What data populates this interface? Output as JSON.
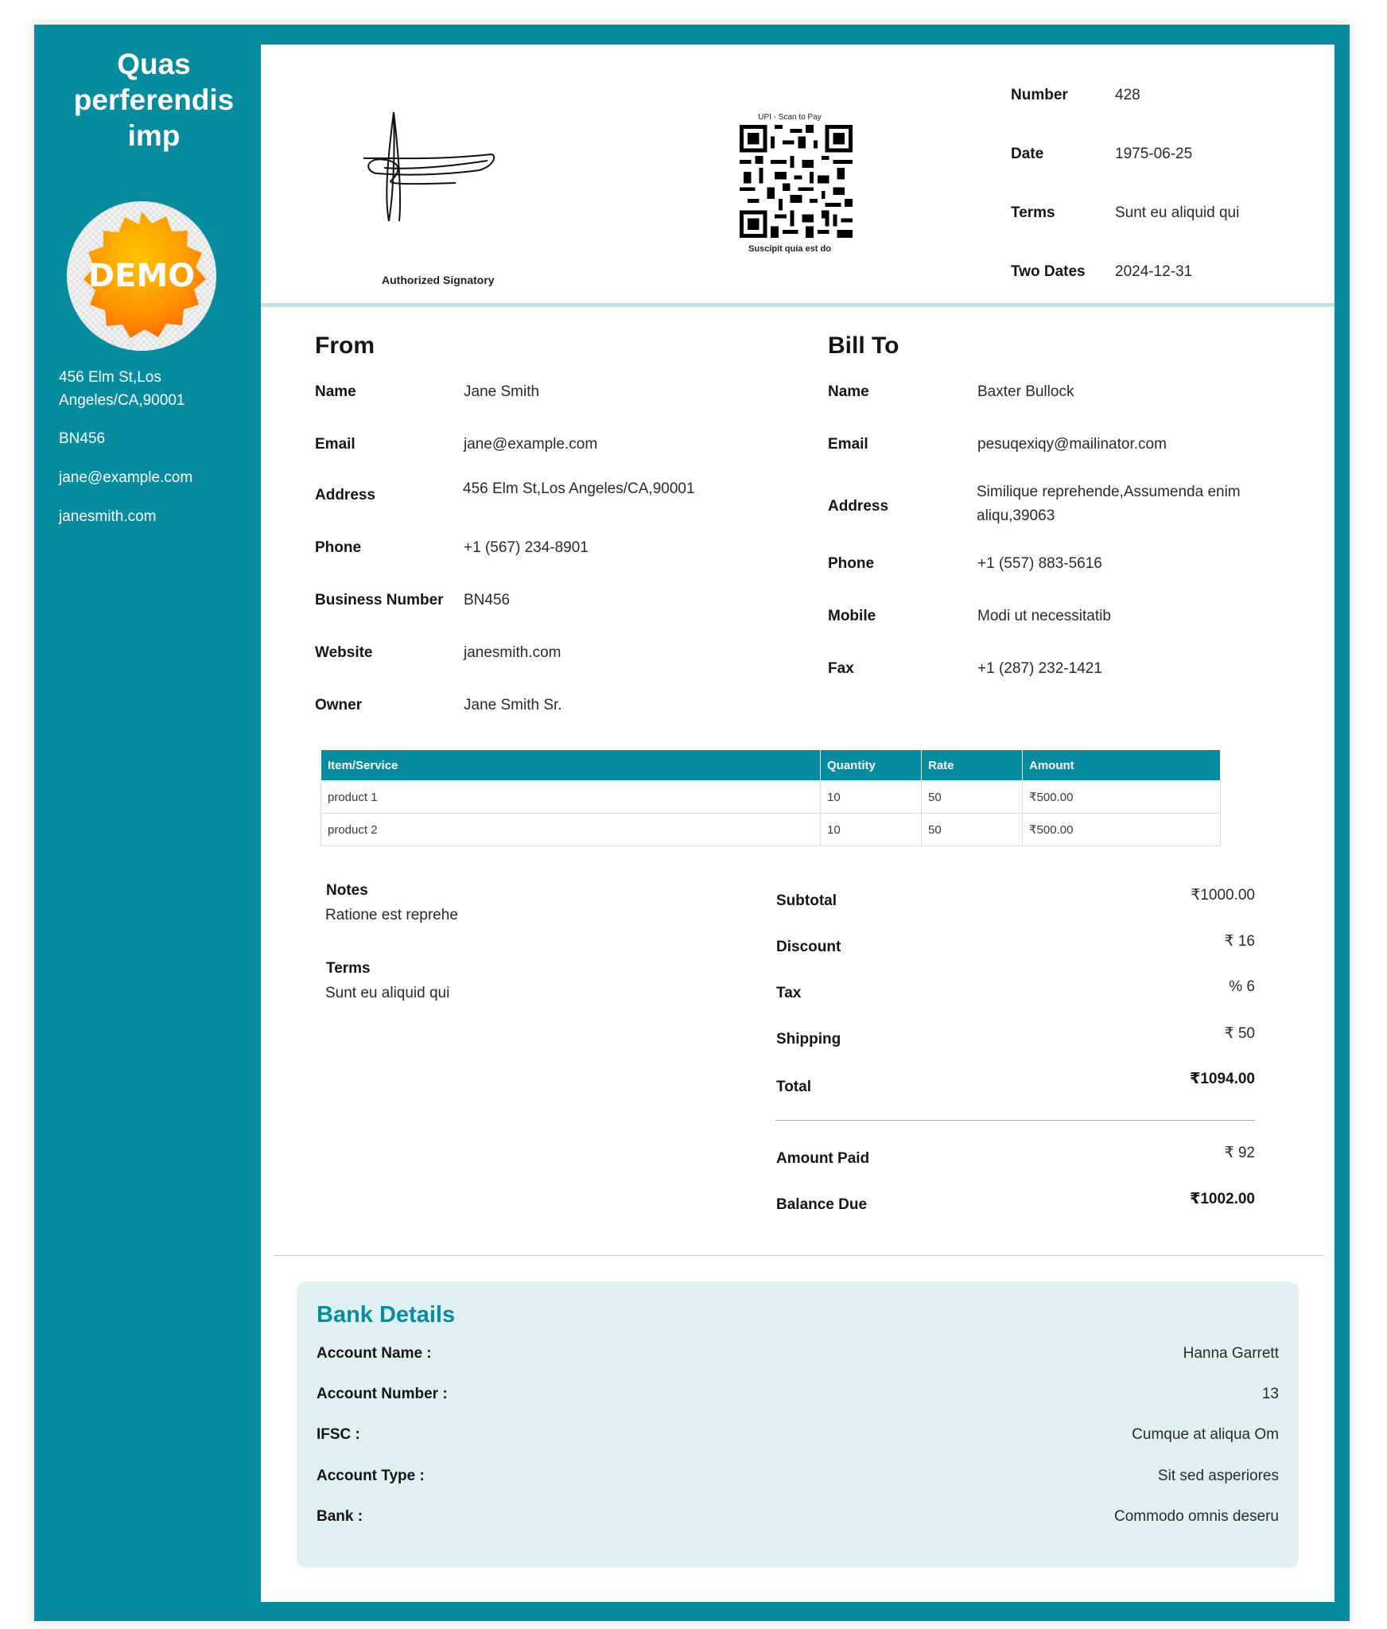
{
  "sidebar": {
    "company_name": "Quas perferendis imp",
    "logo_text": "DEMO",
    "address": "456 Elm St,Los Angeles/CA,90001",
    "business_number": "BN456",
    "email": "jane@example.com",
    "website": "janesmith.com"
  },
  "header": {
    "signature_caption": "Authorized Signatory",
    "qr_top_text": "UPI - Scan to Pay",
    "qr_bottom_text": "Suscipit quia est do",
    "meta": [
      {
        "label": "Number",
        "value": "428"
      },
      {
        "label": "Date",
        "value": "1975-06-25"
      },
      {
        "label": "Terms",
        "value": "Sunt eu aliquid qui"
      },
      {
        "label": "Two Dates",
        "value": "2024-12-31"
      }
    ]
  },
  "from": {
    "heading": "From",
    "rows": [
      {
        "label": "Name",
        "value": "Jane Smith"
      },
      {
        "label": "Email",
        "value": "jane@example.com"
      },
      {
        "label": "Address",
        "value": "456 Elm St,Los Angeles/CA,90001"
      },
      {
        "label": "Phone",
        "value": "+1 (567) 234-8901"
      },
      {
        "label": "Business Number",
        "value": "BN456"
      },
      {
        "label": "Website",
        "value": "janesmith.com"
      },
      {
        "label": "Owner",
        "value": "Jane Smith Sr."
      }
    ]
  },
  "bill_to": {
    "heading": "Bill To",
    "rows": [
      {
        "label": "Name",
        "value": "Baxter Bullock"
      },
      {
        "label": "Email",
        "value": "pesuqexiqy@mailinator.com"
      },
      {
        "label": "Address",
        "value": "Similique reprehende,Assumenda enim aliqu,39063"
      },
      {
        "label": "Phone",
        "value": "+1 (557) 883-5616"
      },
      {
        "label": "Mobile",
        "value": "Modi ut necessitatib"
      },
      {
        "label": "Fax",
        "value": "+1 (287) 232-1421"
      }
    ]
  },
  "items": {
    "headers": [
      "Item/Service",
      "Quantity",
      "Rate",
      "Amount"
    ],
    "rows": [
      [
        "product 1",
        "10",
        "50",
        "₹500.00"
      ],
      [
        "product 2",
        "10",
        "50",
        "₹500.00"
      ]
    ]
  },
  "notes": {
    "label": "Notes",
    "value": "Ratione est reprehe"
  },
  "terms": {
    "label": "Terms",
    "value": "Sunt eu aliquid qui"
  },
  "totals": {
    "rows": [
      {
        "label": "Subtotal",
        "value": "₹1000.00"
      },
      {
        "label": "Discount",
        "value": "₹ 16"
      },
      {
        "label": "Tax",
        "value": "% 6"
      },
      {
        "label": "Shipping",
        "value": "₹ 50"
      },
      {
        "label": "Total",
        "value": "₹1094.00"
      }
    ],
    "amount_paid": {
      "label": "Amount Paid",
      "value": "₹ 92"
    },
    "balance_due": {
      "label": "Balance Due",
      "value": "₹1002.00"
    }
  },
  "bank": {
    "title": "Bank Details",
    "rows": [
      {
        "label": "Account Name :",
        "value": "Hanna Garrett"
      },
      {
        "label": "Account Number :",
        "value": "13"
      },
      {
        "label": "IFSC :",
        "value": "Cumque at aliqua Om"
      },
      {
        "label": "Account Type :",
        "value": "Sit sed asperiores"
      },
      {
        "label": "Bank :",
        "value": "Commodo omnis deseru"
      }
    ]
  },
  "colors": {
    "accent": "#078b9e",
    "bank_bg": "#dff0f3",
    "badge": "#ff8c00"
  }
}
